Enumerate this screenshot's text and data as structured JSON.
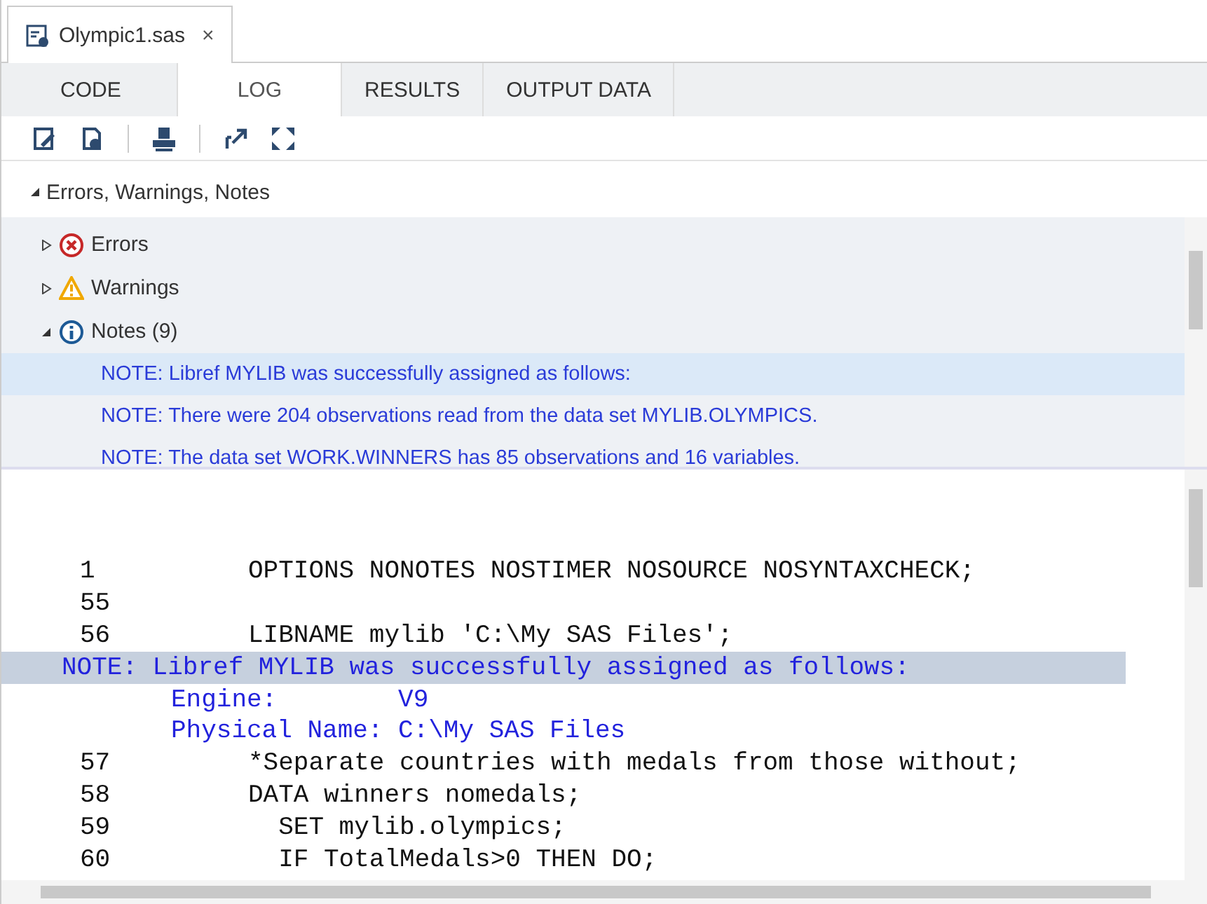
{
  "file_tab": {
    "title": "Olympic1.sas",
    "close": "×"
  },
  "tabs": [
    {
      "label": "CODE",
      "selected": false
    },
    {
      "label": "LOG",
      "selected": true
    },
    {
      "label": "RESULTS",
      "selected": false
    },
    {
      "label": "OUTPUT DATA",
      "selected": false
    }
  ],
  "section": {
    "title": "Errors, Warnings, Notes",
    "expanded": true
  },
  "groups": [
    {
      "kind": "error",
      "label": "Errors",
      "expanded": false
    },
    {
      "kind": "warning",
      "label": "Warnings",
      "expanded": false
    },
    {
      "kind": "info",
      "label": "Notes (9)",
      "expanded": true,
      "items": [
        {
          "text": "NOTE: Libref MYLIB was successfully assigned as follows:",
          "selected": true
        },
        {
          "text": "NOTE: There were 204 observations read from the data set MYLIB.OLYMPICS.",
          "selected": false
        },
        {
          "text": "NOTE: The data set WORK.WINNERS has 85 observations and 16 variables.",
          "selected": false
        }
      ]
    }
  ],
  "log": [
    {
      "kind": "source",
      "number": "1",
      "code": "OPTIONS NONOTES NOSTIMER NOSOURCE NOSYNTAXCHECK;"
    },
    {
      "kind": "source",
      "number": "55"
    },
    {
      "kind": "source",
      "number": "56",
      "code": "LIBNAME mylib 'C:\\My SAS Files';"
    },
    {
      "kind": "note",
      "text": "NOTE: Libref MYLIB was successfully assigned as follows:",
      "selected": true
    },
    {
      "kind": "detail",
      "text": "Engine:        V9"
    },
    {
      "kind": "detail",
      "text": "Physical Name: C:\\My SAS Files"
    },
    {
      "kind": "source",
      "number": "57",
      "code": "*Separate countries with medals from those without;"
    },
    {
      "kind": "source",
      "number": "58",
      "code": "DATA winners nomedals;"
    },
    {
      "kind": "source",
      "number": "59",
      "code": "  SET mylib.olympics;"
    },
    {
      "kind": "source",
      "number": "60",
      "code": "  IF TotalMedals>0 THEN DO;"
    }
  ]
}
